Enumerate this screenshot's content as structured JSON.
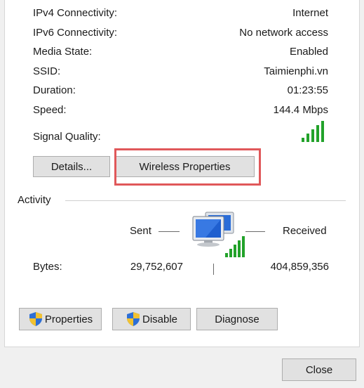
{
  "connection": {
    "rows": [
      {
        "label": "IPv4 Connectivity:",
        "value": "Internet"
      },
      {
        "label": "IPv6 Connectivity:",
        "value": "No network access"
      },
      {
        "label": "Media State:",
        "value": "Enabled"
      },
      {
        "label": "SSID:",
        "value": "Taimienphi.vn"
      },
      {
        "label": "Duration:",
        "value": "01:23:55"
      },
      {
        "label": "Speed:",
        "value": "144.4 Mbps"
      }
    ],
    "signal_label": "Signal Quality:",
    "signal_level": 5,
    "signal_icon": "signal-bars-icon"
  },
  "buttons": {
    "details": "Details...",
    "wireless_properties": "Wireless Properties"
  },
  "activity": {
    "title": "Activity",
    "sent_label": "Sent",
    "received_label": "Received",
    "bytes_label": "Bytes:",
    "bytes_sent": "29,752,607",
    "bytes_received": "404,859,356",
    "icon": "network-computer-icon"
  },
  "bottom_buttons": {
    "properties": "Properties",
    "disable": "Disable",
    "diagnose": "Diagnose",
    "shield_icon": "uac-shield-icon"
  },
  "footer": {
    "close": "Close"
  },
  "colors": {
    "highlight": "#e0585a",
    "signal": "#22a22a",
    "button_bg": "#e1e1e1"
  }
}
